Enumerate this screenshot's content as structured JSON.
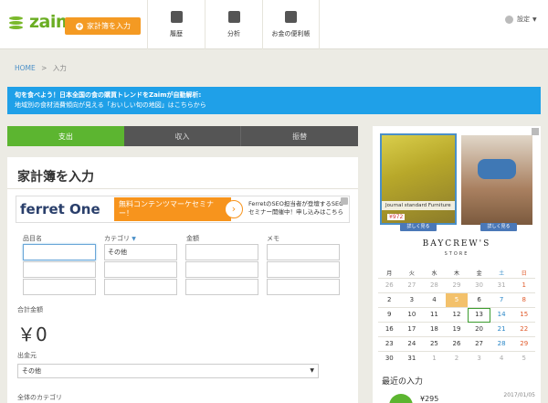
{
  "header": {
    "logo_text": "zaim",
    "input_button": "家計簿を入力",
    "nav": [
      {
        "label": "履歴",
        "icon": "book-icon"
      },
      {
        "label": "分析",
        "icon": "chart-icon"
      },
      {
        "label": "お金の便利帳",
        "icon": "alert-icon"
      }
    ],
    "settings_label": "設定"
  },
  "breadcrumb": {
    "home": "HOME",
    "sep": ">",
    "current": "入力"
  },
  "banner": {
    "line1": "旬を食べよう！日本全国の食の購買トレンドをZaimが自動解析:",
    "line2": "地域別の食材消費傾向が見える「おいしい旬の地図」はこちらから"
  },
  "tabs": [
    {
      "label": "支出",
      "active": true
    },
    {
      "label": "収入",
      "active": false
    },
    {
      "label": "振替",
      "active": false
    }
  ],
  "form": {
    "title": "家計簿を入力",
    "ad": {
      "brand": "ferret One",
      "headline": "無料コンテンツマーケセミナー！",
      "body": "FerretのSEO担当者が登壇するSEOセミナー開催中！申し込みはこちら"
    },
    "columns": [
      "品目名",
      "カテゴリ",
      "金額",
      "メモ"
    ],
    "category_default": "その他",
    "total_label": "合計金額",
    "total_value": "￥0",
    "source_label": "出金元",
    "source_value": "その他",
    "category_all_label": "全体のカテゴリ"
  },
  "side_ad": {
    "item_label": "Journal standard Furniture",
    "price": "¥972",
    "detail_btn": "詳しく見る",
    "brand": "BAYCREW'S",
    "store": "STORE"
  },
  "calendar": {
    "weekdays": [
      "月",
      "火",
      "水",
      "木",
      "金",
      "土",
      "日"
    ],
    "weeks": [
      [
        "26",
        "27",
        "28",
        "29",
        "30",
        "31",
        "1"
      ],
      [
        "2",
        "3",
        "4",
        "5",
        "6",
        "7",
        "8"
      ],
      [
        "9",
        "10",
        "11",
        "12",
        "13",
        "14",
        "15"
      ],
      [
        "16",
        "17",
        "18",
        "19",
        "20",
        "21",
        "22"
      ],
      [
        "23",
        "24",
        "25",
        "26",
        "27",
        "28",
        "29"
      ],
      [
        "30",
        "31",
        "1",
        "2",
        "3",
        "4",
        "5"
      ]
    ],
    "highlighted": "5",
    "selected": "13"
  },
  "recent": {
    "title": "最近の入力",
    "date": "2017/01/05",
    "amount": "¥295"
  },
  "colors": {
    "brand_green": "#6aad22",
    "accent_orange": "#f49a23",
    "banner_blue": "#1fa0e8",
    "tab_green": "#5cb530",
    "tab_dark": "#555555"
  }
}
